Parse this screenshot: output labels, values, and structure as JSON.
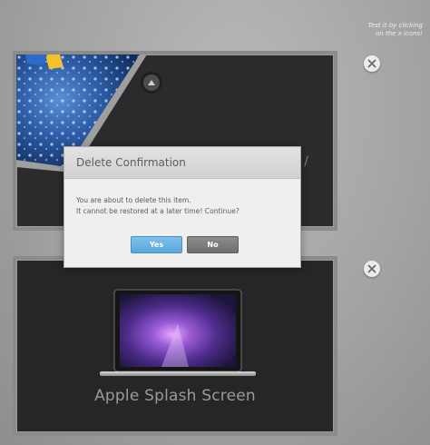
{
  "hint_text": [
    "Test it by clicking",
    "on the x icons!"
  ],
  "cards": [
    {
      "title": "",
      "partial_text": "/"
    },
    {
      "title": "Apple Splash Screen"
    }
  ],
  "dialog": {
    "title": "Delete Confirmation",
    "message_line1": "You are about to delete this item.",
    "message_line2": "It cannot be restored at a later time! Continue?",
    "yes_label": "Yes",
    "no_label": "No"
  },
  "colors": {
    "yes_button": "#6ab3e2",
    "no_button": "#7c7c7c",
    "card_bg": "#2b2b2d"
  },
  "icons": [
    "close-icon",
    "arrow-up-icon"
  ]
}
